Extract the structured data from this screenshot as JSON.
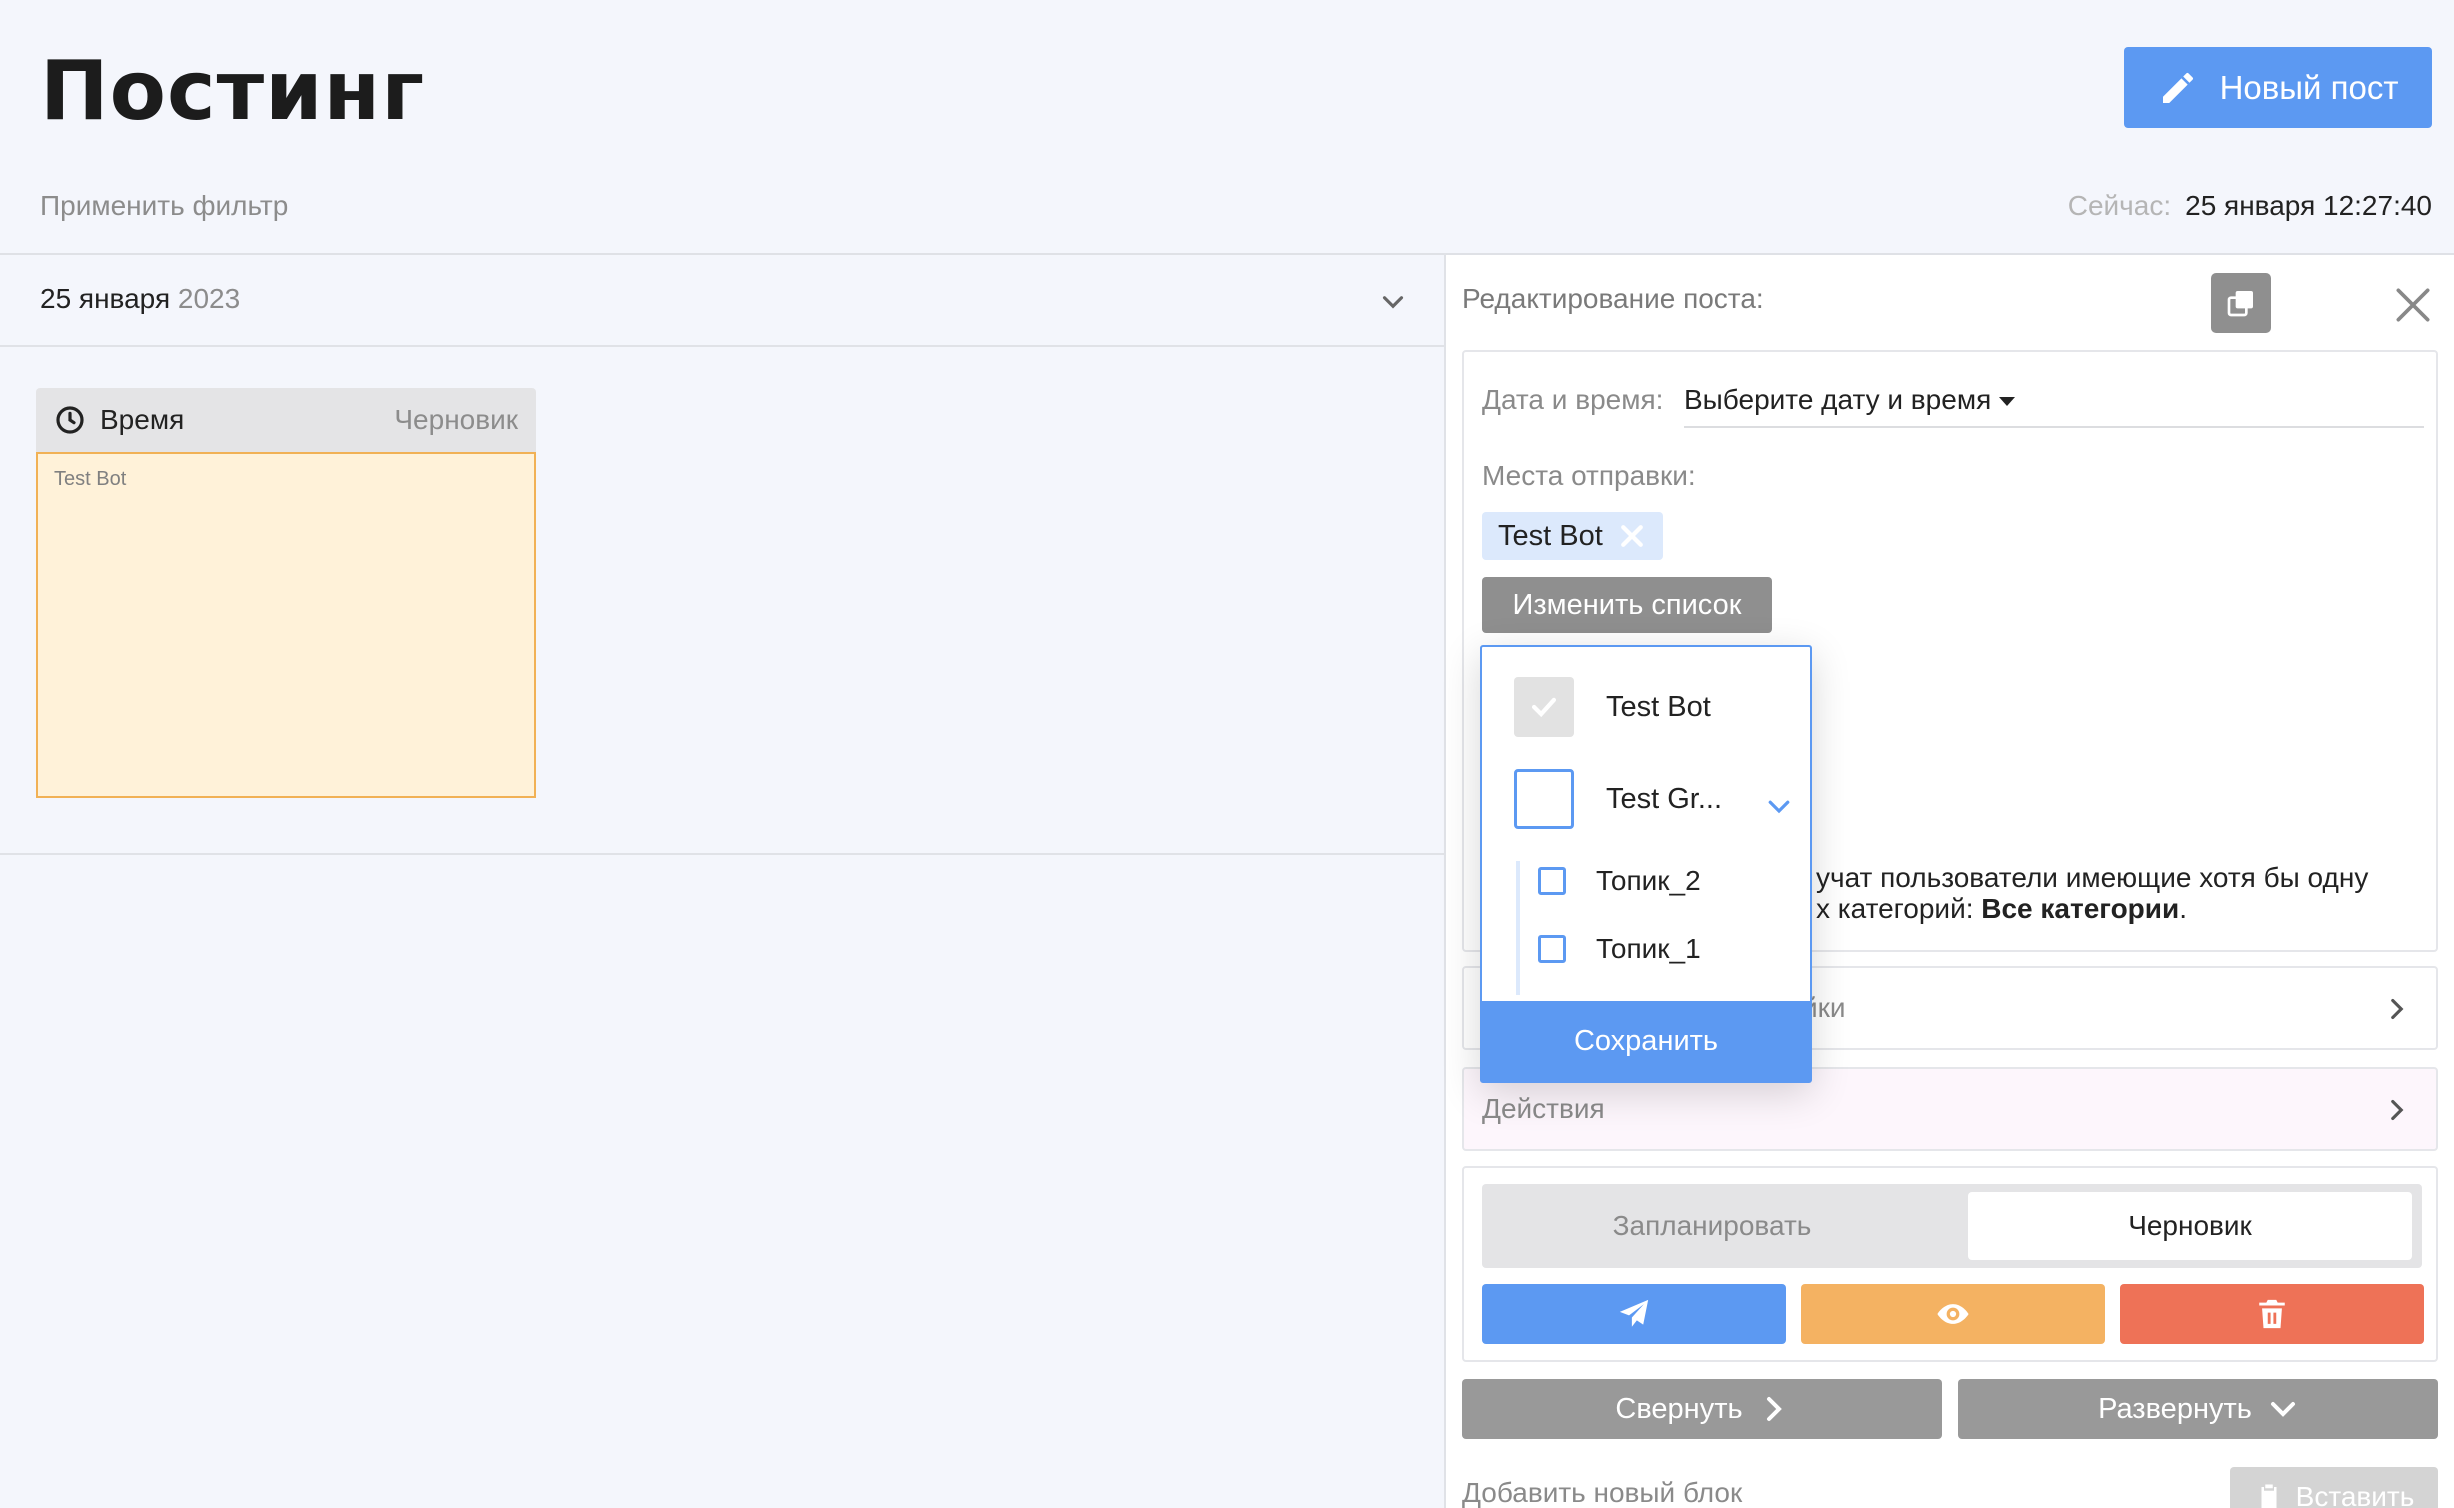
{
  "header": {
    "title": "Постинг",
    "new_post_label": "Новый пост",
    "filter_label": "Применить фильтр",
    "now_label": "Сейчас:",
    "now_value": "25 января 12:27:40"
  },
  "left": {
    "date_day": "25 января",
    "date_year": "2023",
    "card": {
      "time_label": "Время",
      "status": "Черновик",
      "body": "Test Bot"
    }
  },
  "editor": {
    "title": "Редактирование поста:",
    "datetime_label": "Дата и время:",
    "datetime_placeholder": "Выберите дату и время",
    "destinations_label": "Места отправки:",
    "chip_label": "Test Bot",
    "change_list_label": "Изменить список",
    "note_line1": "учат пользователи имеющие хотя бы одну",
    "note_line2_prefix": "х категорий: ",
    "note_line2_bold": "Все категории",
    "note_line2_suffix": ".",
    "settings_label_partial": "йки",
    "actions_label": "Действия",
    "schedule_label": "Запланировать",
    "draft_label": "Черновик",
    "collapse_label": "Свернуть",
    "expand_label": "Развернуть",
    "add_block_label": "Добавить новый блок",
    "paste_label": "Вставить"
  },
  "dropdown": {
    "items": [
      {
        "label": "Test Bot",
        "checked": true,
        "disabled": true
      },
      {
        "label": "Test Gr...",
        "checked": false,
        "expandable": true
      }
    ],
    "subitems": [
      {
        "label": "Топик_2",
        "checked": false
      },
      {
        "label": "Топик_1",
        "checked": false
      }
    ],
    "save_label": "Сохранить"
  },
  "colors": {
    "accent": "#5c99f2",
    "warning": "#f4b262",
    "danger": "#ee7257",
    "draft_bg": "#fff2d9",
    "draft_border": "#f1b155",
    "chip_bg": "#dce9fc",
    "neutral_button": "#8f8f8f"
  },
  "icons": [
    "pencil-icon",
    "clock-icon",
    "chevron-down-icon",
    "copy-icon",
    "bell-icon",
    "close-icon",
    "remove-icon",
    "check-icon",
    "chevron-right-icon",
    "paper-plane-icon",
    "eye-icon",
    "trash-icon",
    "clipboard-icon"
  ]
}
